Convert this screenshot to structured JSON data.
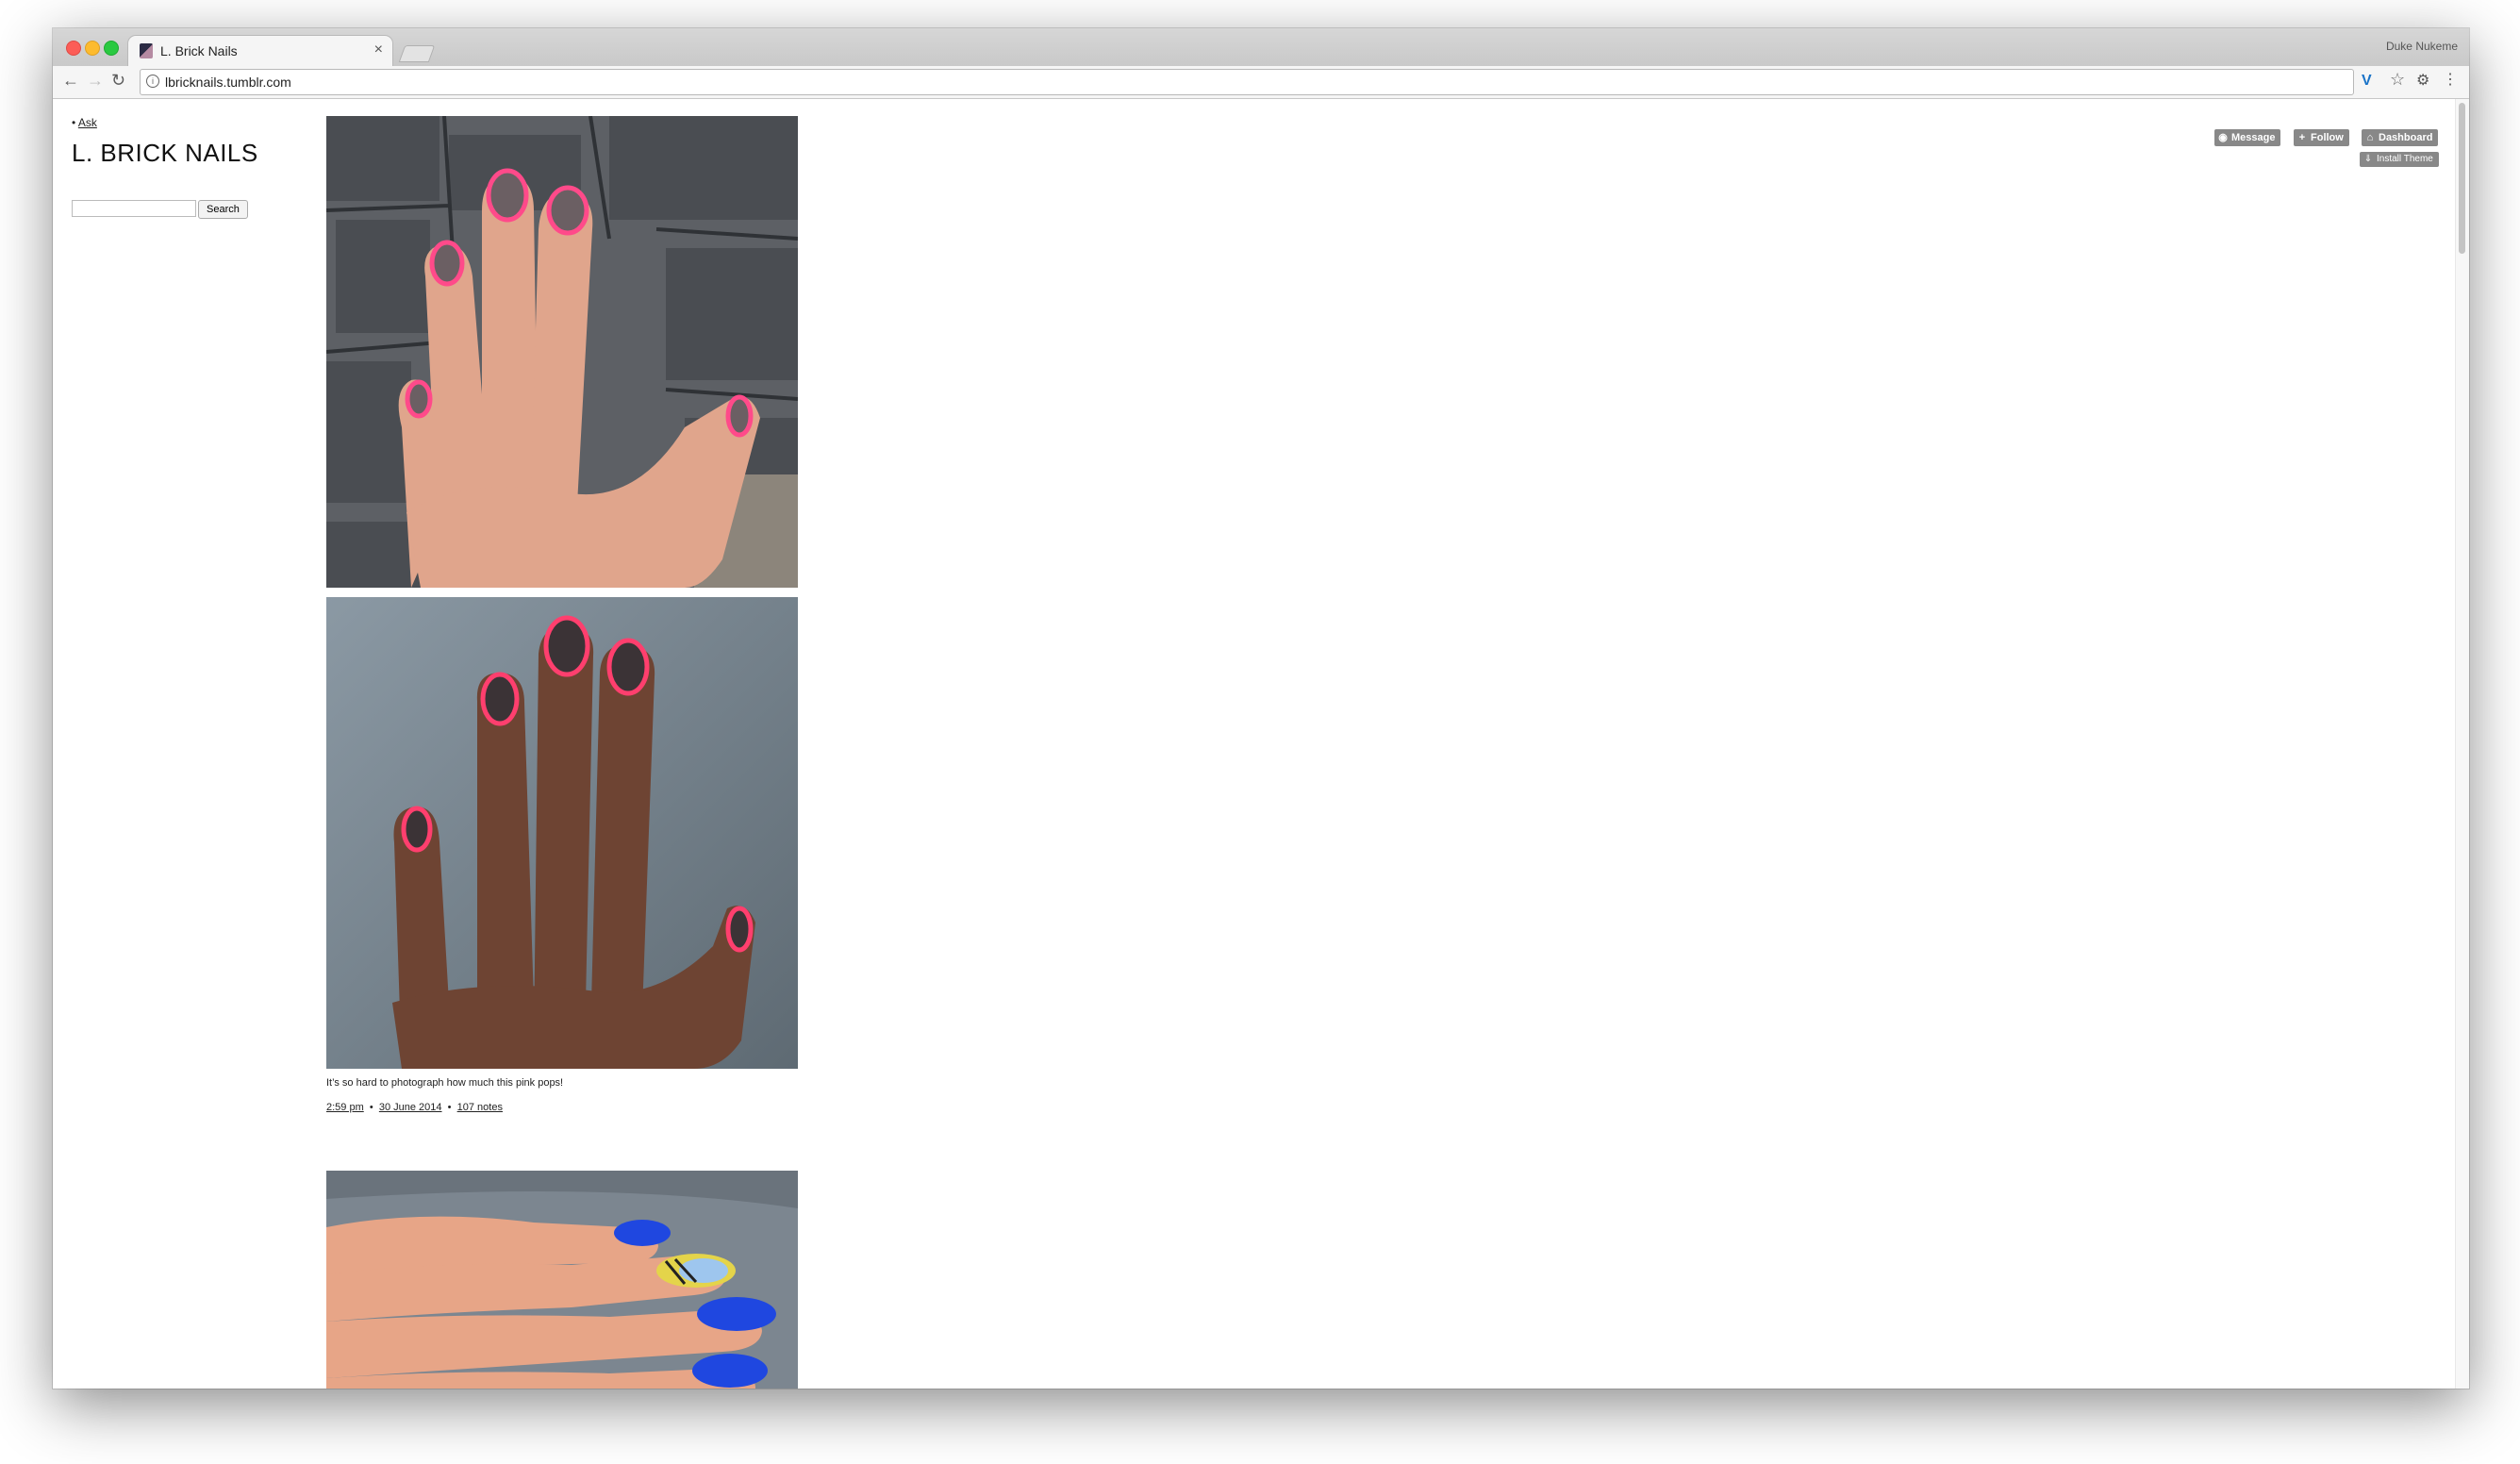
{
  "browser": {
    "tab_title": "L. Brick Nails",
    "tab_close": "×",
    "profile_name": "Duke Nukeme",
    "url": "lbricknails.tumblr.com",
    "icons": [
      "back-icon",
      "forward-icon",
      "reload-icon",
      "info-icon",
      "vimium-icon",
      "star-icon",
      "extension-icon",
      "menu-icon"
    ]
  },
  "sidebar": {
    "bullet": "•",
    "ask_link": "Ask",
    "blog_title": "L. BRICK NAILS",
    "search_placeholder": "",
    "search_button": "Search"
  },
  "tumblr_controls": {
    "message": "Message",
    "follow": "Follow",
    "dashboard": "Dashboard",
    "install_theme": "Install Theme"
  },
  "post": {
    "caption": "It’s so hard to photograph how much this pink pops!",
    "time": "2:59 pm",
    "date": "30 June 2014",
    "notes": "107 notes",
    "separator": "•"
  }
}
